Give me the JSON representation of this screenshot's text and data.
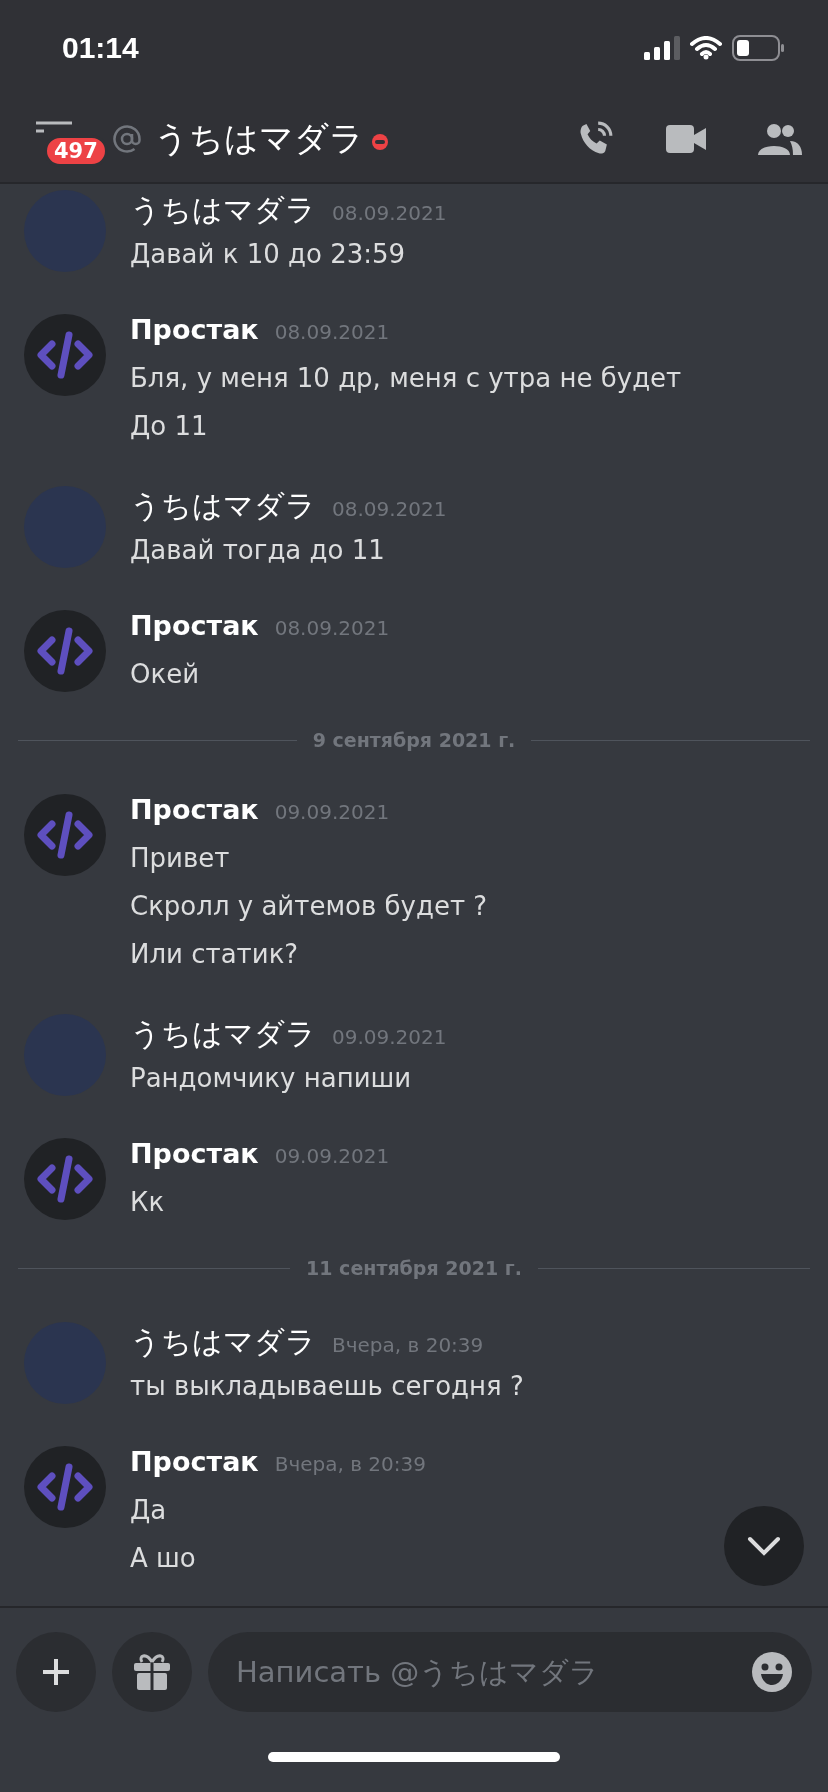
{
  "status_bar": {
    "time": "01:14"
  },
  "header": {
    "unread_badge": "497",
    "title": "うちはマダラ",
    "status_dot": {
      "color": "#ed4245"
    }
  },
  "messages": [
    {
      "kind": "message",
      "avatar": {
        "kind": "photo"
      },
      "author": "うちはマダラ",
      "author_bold": false,
      "timestamp": "08.09.2021",
      "lines": [
        "Давай к 10 до 23:59"
      ]
    },
    {
      "kind": "message",
      "avatar": {
        "kind": "code"
      },
      "author": "Простак",
      "author_bold": true,
      "timestamp": "08.09.2021",
      "lines": [
        "Бля, у меня 10 др, меня с утра не будет",
        "До 11"
      ]
    },
    {
      "kind": "message",
      "avatar": {
        "kind": "photo"
      },
      "author": "うちはマダラ",
      "author_bold": false,
      "timestamp": "08.09.2021",
      "lines": [
        "Давай тогда до 11"
      ]
    },
    {
      "kind": "message",
      "avatar": {
        "kind": "code"
      },
      "author": "Простак",
      "author_bold": true,
      "timestamp": "08.09.2021",
      "lines": [
        "Окей"
      ]
    },
    {
      "kind": "date_divider",
      "label": "9 сентября 2021 г."
    },
    {
      "kind": "message",
      "avatar": {
        "kind": "code"
      },
      "author": "Простак",
      "author_bold": true,
      "timestamp": "09.09.2021",
      "lines": [
        "Привет",
        "Скролл у айтемов будет ?",
        "Или статик?"
      ]
    },
    {
      "kind": "message",
      "avatar": {
        "kind": "photo"
      },
      "author": "うちはマダラ",
      "author_bold": false,
      "timestamp": "09.09.2021",
      "lines": [
        "Рандомчику напиши"
      ]
    },
    {
      "kind": "message",
      "avatar": {
        "kind": "code"
      },
      "author": "Простак",
      "author_bold": true,
      "timestamp": "09.09.2021",
      "lines": [
        "Кк"
      ]
    },
    {
      "kind": "date_divider",
      "label": "11 сентября 2021 г."
    },
    {
      "kind": "message",
      "avatar": {
        "kind": "photo"
      },
      "author": "うちはマダラ",
      "author_bold": false,
      "timestamp": "Вчера, в 20:39",
      "lines": [
        "ты выкладываешь сегодня ?"
      ]
    },
    {
      "kind": "message",
      "avatar": {
        "kind": "code"
      },
      "author": "Простак",
      "author_bold": true,
      "timestamp": "Вчера, в 20:39",
      "lines": [
        "Да",
        "А шо"
      ]
    }
  ],
  "composer": {
    "placeholder": "Написать @うちはマダラ"
  }
}
